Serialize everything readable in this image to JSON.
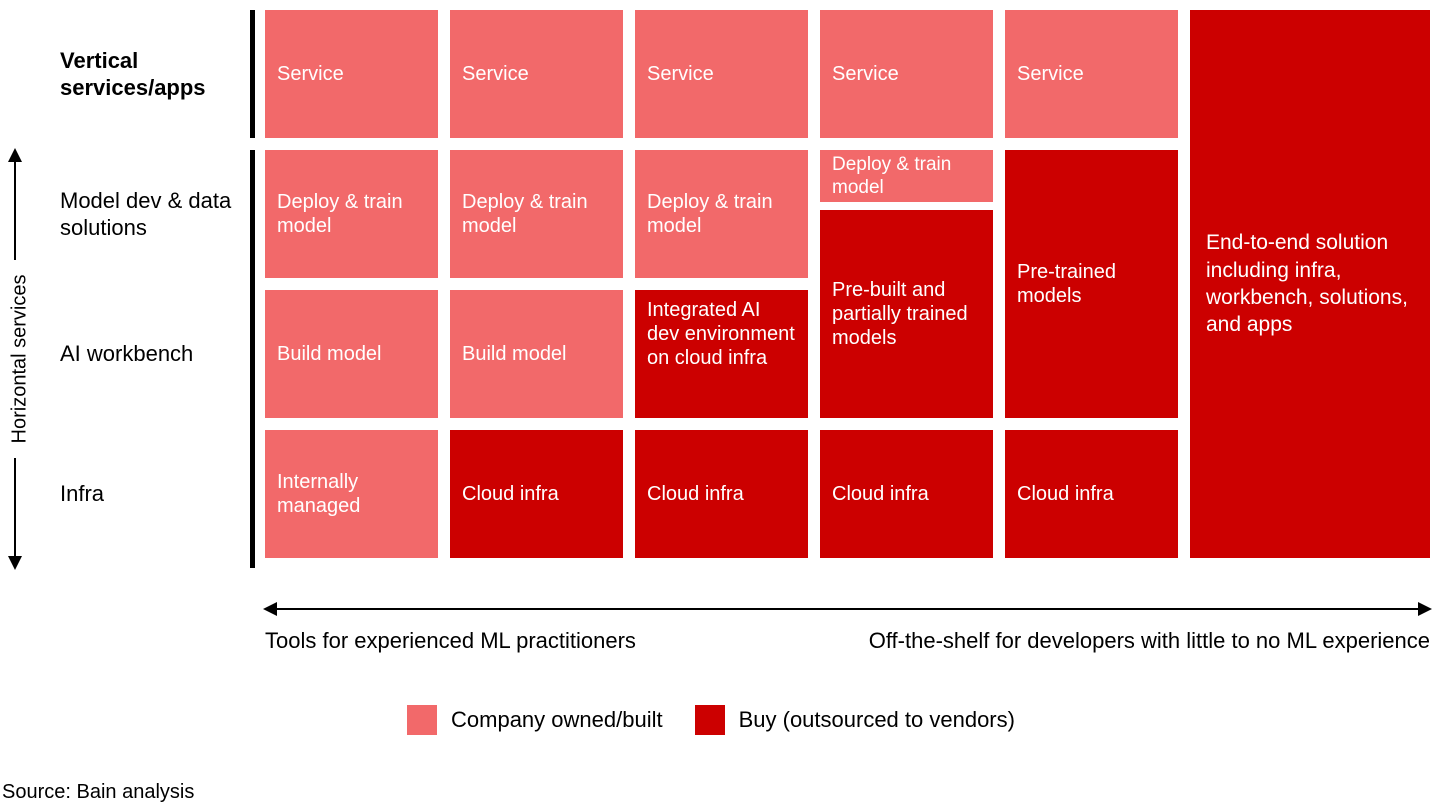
{
  "row_labels": {
    "r0": "Vertical services/apps",
    "r1": "Model dev & data solutions",
    "r2": "AI workbench",
    "r3": "Infra"
  },
  "vaxis_label": "Horizontal services",
  "haxis": {
    "left": "Tools for experienced ML practitioners",
    "right": "Off-the-shelf for developers with little to no ML experience"
  },
  "legend": {
    "light": "Company owned/built",
    "dark": "Buy (outsourced to vendors)"
  },
  "source": "Source: Bain analysis",
  "col1": {
    "r0": "Service",
    "r1": "Deploy & train model",
    "r2": "Build model",
    "r3": "Internally managed"
  },
  "col2": {
    "r0": "Service",
    "r1": "Deploy & train model",
    "r2": "Build model",
    "r3": "Cloud infra"
  },
  "col3": {
    "r0": "Service",
    "r1": "Deploy & train model",
    "r2": "Integrated AI dev environment on cloud infra",
    "r3": "Cloud infra"
  },
  "col4": {
    "r0": "Service",
    "r1a": "Deploy & train model",
    "r1b": "Pre-built and partially trained models",
    "r3": "Cloud infra"
  },
  "col5": {
    "r0": "Service",
    "r12": "Pre-trained models",
    "r3": "Cloud infra"
  },
  "col6": {
    "big": "End-to-end solution including infra, workbench, solutions, and apps"
  },
  "chart_data": {
    "type": "table",
    "title": "AI stack build-vs-buy spectrum",
    "row_axis_label": "Horizontal services",
    "col_axis_left": "Tools for experienced ML practitioners",
    "col_axis_right": "Off-the-shelf for developers with little to no ML experience",
    "legend": {
      "build": "Company owned/built",
      "buy": "Buy (outsourced to vendors)"
    },
    "rows": [
      "Vertical services/apps",
      "Model dev & data solutions",
      "AI workbench",
      "Infra"
    ],
    "columns": [
      "Col1",
      "Col2",
      "Col3",
      "Col4",
      "Col5",
      "Col6"
    ],
    "cells": [
      {
        "col": "Col1",
        "row": "Vertical services/apps",
        "label": "Service",
        "class": "build"
      },
      {
        "col": "Col1",
        "row": "Model dev & data solutions",
        "label": "Deploy & train model",
        "class": "build"
      },
      {
        "col": "Col1",
        "row": "AI workbench",
        "label": "Build model",
        "class": "build"
      },
      {
        "col": "Col1",
        "row": "Infra",
        "label": "Internally managed",
        "class": "build"
      },
      {
        "col": "Col2",
        "row": "Vertical services/apps",
        "label": "Service",
        "class": "build"
      },
      {
        "col": "Col2",
        "row": "Model dev & data solutions",
        "label": "Deploy & train model",
        "class": "build"
      },
      {
        "col": "Col2",
        "row": "AI workbench",
        "label": "Build model",
        "class": "build"
      },
      {
        "col": "Col2",
        "row": "Infra",
        "label": "Cloud infra",
        "class": "buy"
      },
      {
        "col": "Col3",
        "row": "Vertical services/apps",
        "label": "Service",
        "class": "build"
      },
      {
        "col": "Col3",
        "row": "Model dev & data solutions",
        "label": "Deploy & train model",
        "class": "build"
      },
      {
        "col": "Col3",
        "row": "AI workbench",
        "label": "Integrated AI dev environment on cloud infra",
        "class": "buy"
      },
      {
        "col": "Col3",
        "row": "Infra",
        "label": "Cloud infra",
        "class": "buy"
      },
      {
        "col": "Col4",
        "row": "Vertical services/apps",
        "label": "Service",
        "class": "build"
      },
      {
        "col": "Col4",
        "row": "Model dev & data solutions",
        "label": "Deploy & train model",
        "class": "build",
        "note": "thin"
      },
      {
        "col": "Col4",
        "row_span": [
          "Model dev & data solutions",
          "AI workbench"
        ],
        "label": "Pre-built and partially trained models",
        "class": "buy"
      },
      {
        "col": "Col4",
        "row": "Infra",
        "label": "Cloud infra",
        "class": "buy"
      },
      {
        "col": "Col5",
        "row": "Vertical services/apps",
        "label": "Service",
        "class": "build"
      },
      {
        "col": "Col5",
        "row_span": [
          "Model dev & data solutions",
          "AI workbench"
        ],
        "label": "Pre-trained models",
        "class": "buy"
      },
      {
        "col": "Col5",
        "row": "Infra",
        "label": "Cloud infra",
        "class": "buy"
      },
      {
        "col": "Col6",
        "row_span": [
          "Vertical services/apps",
          "Model dev & data solutions",
          "AI workbench",
          "Infra"
        ],
        "label": "End-to-end solution including infra, workbench, solutions, and apps",
        "class": "buy"
      }
    ]
  }
}
